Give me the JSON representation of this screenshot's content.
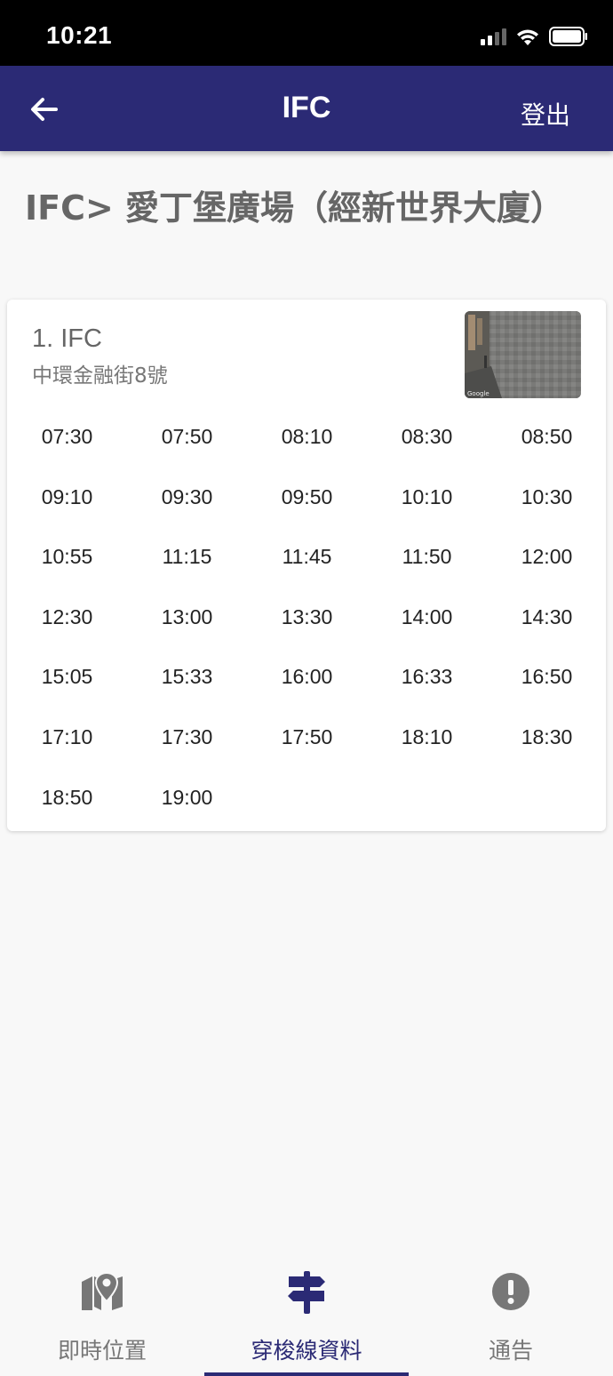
{
  "status_bar": {
    "time": "10:21",
    "signal_icon": "cellular-signal-icon",
    "wifi_icon": "wifi-icon",
    "battery_icon": "battery-icon"
  },
  "app_bar": {
    "back_icon": "arrow-left-icon",
    "title": "IFC",
    "logout_label": "登出",
    "color": "#2b2a75"
  },
  "route": {
    "title": "IFC> 愛丁堡廣場（經新世界大廈）"
  },
  "stop": {
    "name": "1. IFC",
    "address": "中環金融街8號",
    "photo": "street-view-photo",
    "times": [
      "07:30",
      "07:50",
      "08:10",
      "08:30",
      "08:50",
      "09:10",
      "09:30",
      "09:50",
      "10:10",
      "10:30",
      "10:55",
      "11:15",
      "11:45",
      "11:50",
      "12:00",
      "12:30",
      "13:00",
      "13:30",
      "14:00",
      "14:30",
      "15:05",
      "15:33",
      "16:00",
      "16:33",
      "16:50",
      "17:10",
      "17:30",
      "17:50",
      "18:10",
      "18:30",
      "18:50",
      "19:00"
    ]
  },
  "bottom_nav": {
    "items": [
      {
        "label": "即時位置",
        "icon": "map-pin-icon",
        "active": false
      },
      {
        "label": "穿梭線資料",
        "icon": "signpost-icon",
        "active": true
      },
      {
        "label": "通告",
        "icon": "alert-circle-icon",
        "active": false
      }
    ],
    "active_color": "#2b2a75",
    "inactive_color": "#777777"
  }
}
